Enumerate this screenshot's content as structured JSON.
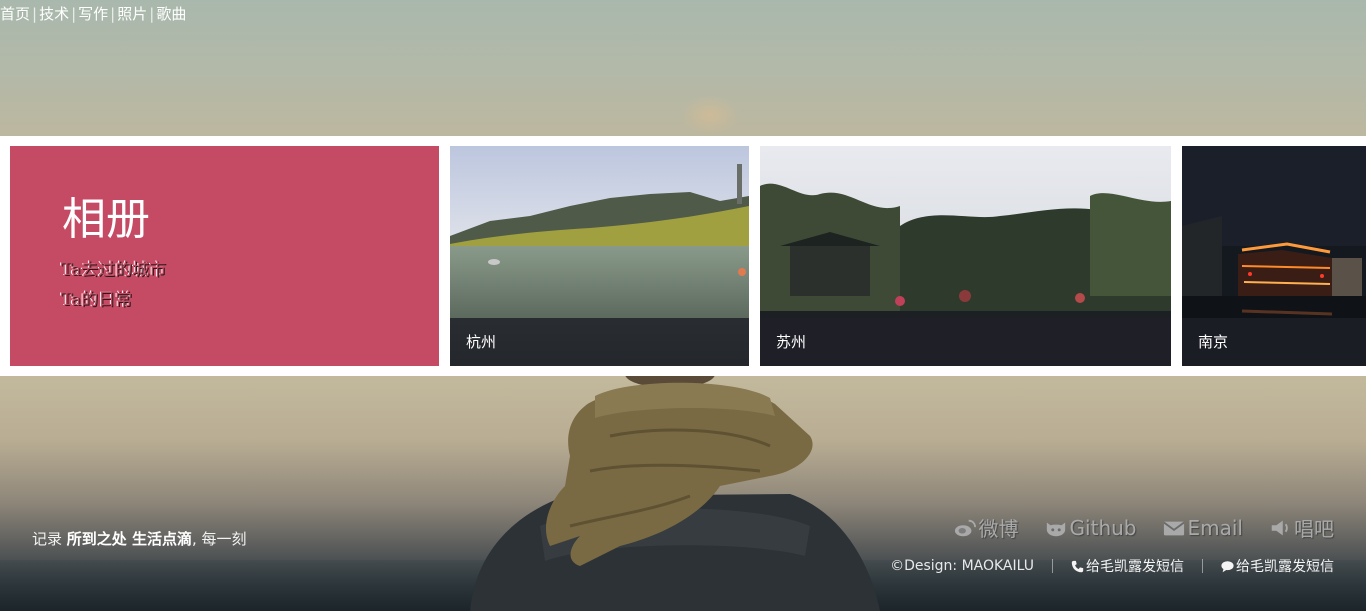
{
  "nav": {
    "items": [
      {
        "label": "首页"
      },
      {
        "label": "技术"
      },
      {
        "label": "写作"
      },
      {
        "label": "照片"
      },
      {
        "label": "歌曲"
      }
    ],
    "separator": "|"
  },
  "album": {
    "title": "相册",
    "line1": "Ta去过的城市",
    "line2": "Ta的日常",
    "accent_color": "#c44b63",
    "cities": [
      {
        "name": "杭州"
      },
      {
        "name": "苏州"
      },
      {
        "name": "南京"
      }
    ]
  },
  "footer": {
    "quote_prefix": "记录 ",
    "quote_strong": "所到之处 生活点滴",
    "quote_suffix": ", 每一刻",
    "social": [
      {
        "icon": "weibo-icon",
        "label": "微博"
      },
      {
        "icon": "github-icon",
        "label": "Github"
      },
      {
        "icon": "email-icon",
        "label": "Email"
      },
      {
        "icon": "speaker-icon",
        "label": "唱吧"
      }
    ],
    "design": "©Design: MAOKAILU",
    "sms": [
      {
        "icon": "phone-icon",
        "label": "给毛凯露发短信"
      },
      {
        "icon": "chat-bubble-icon",
        "label": "给毛凯露发短信"
      }
    ]
  }
}
